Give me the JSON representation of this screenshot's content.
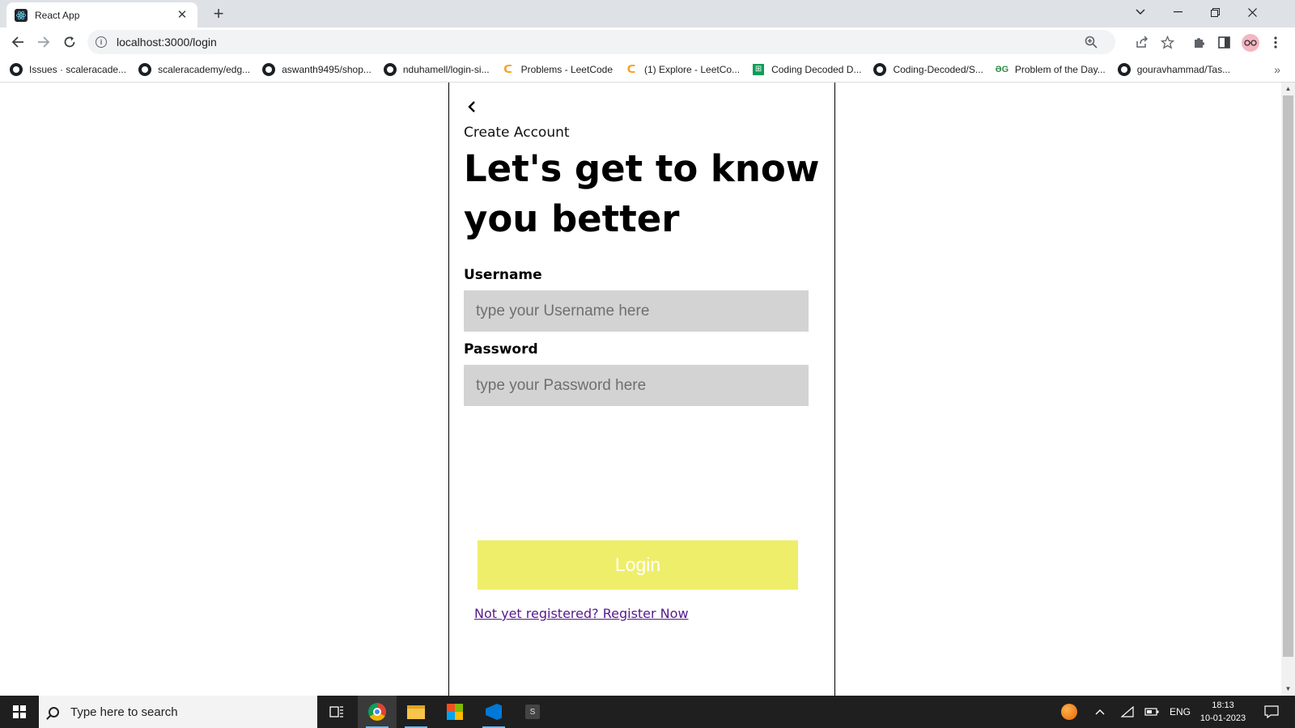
{
  "browser": {
    "tab_title": "React App",
    "tab_close": "✕",
    "new_tab": "+",
    "url": "localhost:3000/login",
    "bookmarks": [
      {
        "icon": "github-icon",
        "label": "Issues · scaleracade..."
      },
      {
        "icon": "github-icon",
        "label": "scaleracademy/edg..."
      },
      {
        "icon": "github-icon",
        "label": "aswanth9495/shop..."
      },
      {
        "icon": "github-icon",
        "label": "nduhamell/login-si..."
      },
      {
        "icon": "leetcode-icon",
        "label": "Problems - LeetCode"
      },
      {
        "icon": "leetcode-icon",
        "label": "(1) Explore - LeetCo..."
      },
      {
        "icon": "sheets-icon",
        "label": "Coding Decoded D..."
      },
      {
        "icon": "github-icon",
        "label": "Coding-Decoded/S..."
      },
      {
        "icon": "gfg-icon",
        "label": "Problem of the Day..."
      },
      {
        "icon": "github-icon",
        "label": "gouravhammad/Tas..."
      }
    ],
    "bookmarks_more": "»"
  },
  "page": {
    "back_glyph": "<",
    "kicker": "Create Account",
    "headline": "Let's get to know you better",
    "username_label": "Username",
    "username_placeholder": "type your Username here",
    "username_value": "",
    "password_label": "Password",
    "password_placeholder": "type your Password here",
    "password_value": "",
    "login_label": "Login",
    "register_link": "Not yet registered? Register Now"
  },
  "taskbar": {
    "search_placeholder": "Type here to search",
    "language": "ENG",
    "time": "18:13",
    "date": "10-01-2023",
    "sapp_letter": "S"
  },
  "colors": {
    "login_button": "#eeee6b",
    "input_background": "#d3d3d3",
    "link": "#551a8b"
  }
}
